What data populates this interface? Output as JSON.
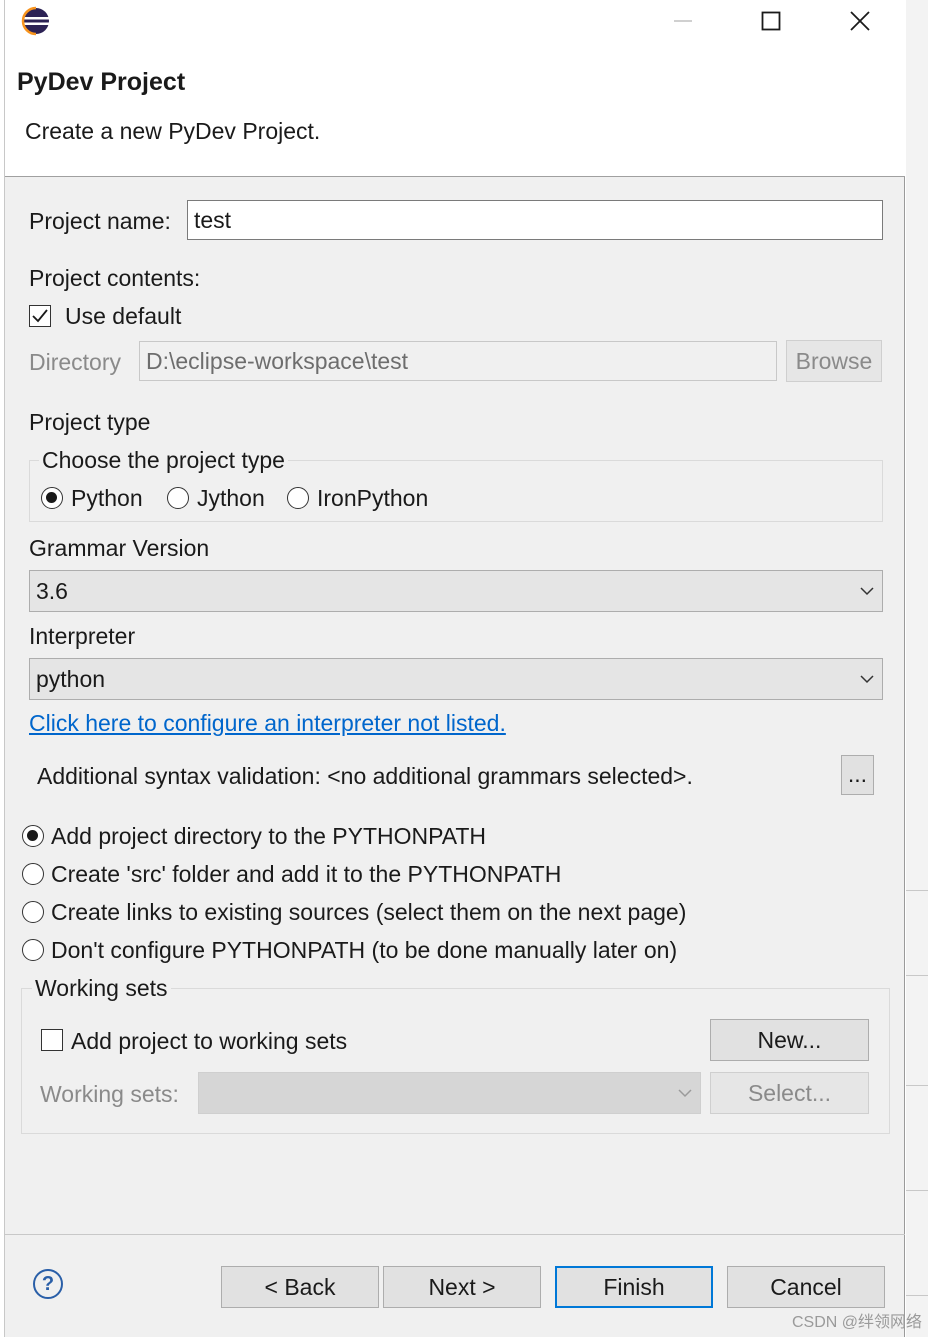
{
  "window": {
    "title": "PyDev Project",
    "subtitle": "Create a new PyDev Project.",
    "minimize_icon": "minimize-icon",
    "maximize_icon": "maximize-icon",
    "close_icon": "close-icon"
  },
  "project_name": {
    "label": "Project name:",
    "value": "test"
  },
  "contents": {
    "label": "Project contents:",
    "use_default_label": "Use default",
    "use_default_checked": true,
    "directory_label": "Directory",
    "directory_value": "D:\\eclipse-workspace\\test",
    "browse_label": "Browse"
  },
  "project_type": {
    "label": "Project type",
    "group_title": "Choose the project type",
    "options": [
      "Python",
      "Jython",
      "IronPython"
    ],
    "selected": "Python"
  },
  "grammar": {
    "label": "Grammar Version",
    "value": "3.6"
  },
  "interpreter": {
    "label": "Interpreter",
    "value": "python",
    "configure_link": "Click here to configure an interpreter not listed."
  },
  "syntax": {
    "label": "Additional syntax validation: <no additional grammars selected>.",
    "button": "..."
  },
  "pythonpath": {
    "options": [
      "Add project directory to the PYTHONPATH",
      "Create 'src' folder and add it to the PYTHONPATH",
      "Create links to existing sources (select them on the next page)",
      "Don't configure PYTHONPATH (to be done manually later on)"
    ],
    "selected_index": 0
  },
  "working_sets": {
    "group_title": "Working sets",
    "add_label": "Add project to working sets",
    "add_checked": false,
    "new_button": "New...",
    "sets_label": "Working sets:",
    "select_button": "Select..."
  },
  "footer": {
    "back": "< Back",
    "next": "Next >",
    "finish": "Finish",
    "cancel": "Cancel"
  },
  "watermark": "CSDN @绊领网络",
  "colors": {
    "link": "#0066cc",
    "default_button_border": "#0078d7",
    "dialog_bg": "#f0f0f0"
  }
}
